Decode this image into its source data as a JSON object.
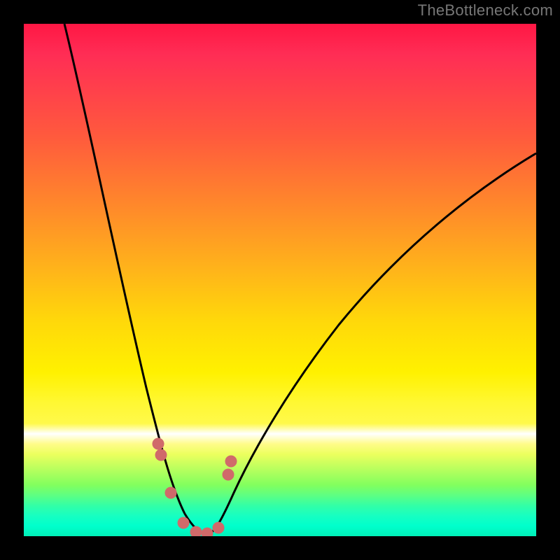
{
  "watermark": "TheBottleneck.com",
  "chart_data": {
    "type": "line",
    "title": "",
    "xlabel": "",
    "ylabel": "",
    "x_range": [
      0,
      100
    ],
    "y_range": [
      0,
      100
    ],
    "grid": false,
    "legend": false,
    "note": "V-shaped bottleneck curve plotted over a red-to-green vertical gradient; minimum (optimal balance) around x≈32.",
    "background_gradient": {
      "top_color": "#ff1744",
      "mid_color": "#fff100",
      "bottom_color": "#00f0b8"
    },
    "series": [
      {
        "name": "left-branch",
        "x": [
          8,
          12,
          16,
          20,
          24,
          26,
          28,
          30,
          32,
          34,
          36
        ],
        "y": [
          100,
          82,
          64,
          48,
          33,
          25,
          18,
          11,
          6,
          2,
          0
        ]
      },
      {
        "name": "right-branch",
        "x": [
          36,
          40,
          44,
          50,
          56,
          62,
          70,
          78,
          86,
          94,
          100
        ],
        "y": [
          0,
          3,
          8,
          16,
          24,
          32,
          42,
          52,
          62,
          70,
          75
        ]
      },
      {
        "name": "markers",
        "style": "dots",
        "color": "#d06a6a",
        "x": [
          26,
          26,
          28,
          30,
          32,
          34,
          36,
          38,
          38
        ],
        "y": [
          18,
          16,
          8,
          2,
          0.5,
          0.5,
          2,
          12,
          15
        ]
      }
    ]
  }
}
